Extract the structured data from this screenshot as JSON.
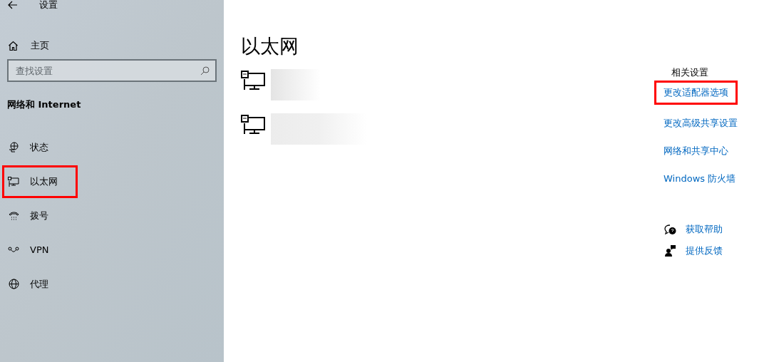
{
  "window": {
    "title": "设置"
  },
  "sidebar": {
    "home": "主页",
    "search": {
      "placeholder": "查找设置"
    },
    "section": "网络和 Internet",
    "items": [
      {
        "kind": "status",
        "label": "状态",
        "highlighted": false
      },
      {
        "kind": "ethernet",
        "label": "以太网",
        "highlighted": true
      },
      {
        "kind": "dialup",
        "label": "拨号",
        "highlighted": false
      },
      {
        "kind": "vpn",
        "label": "VPN",
        "highlighted": false
      },
      {
        "kind": "proxy",
        "label": "代理",
        "highlighted": false
      }
    ]
  },
  "main": {
    "title": "以太网",
    "adapters": [
      {
        "redacted": true
      },
      {
        "redacted": true
      }
    ]
  },
  "related": {
    "heading": "相关设置",
    "links": [
      {
        "label": "更改适配器选项",
        "highlighted": true
      },
      {
        "label": "更改高级共享设置",
        "highlighted": false
      },
      {
        "label": "网络和共享中心",
        "highlighted": false
      },
      {
        "label": "Windows 防火墙",
        "highlighted": false
      }
    ],
    "help": [
      {
        "kind": "help",
        "label": "获取帮助"
      },
      {
        "kind": "feedback",
        "label": "提供反馈"
      }
    ]
  }
}
